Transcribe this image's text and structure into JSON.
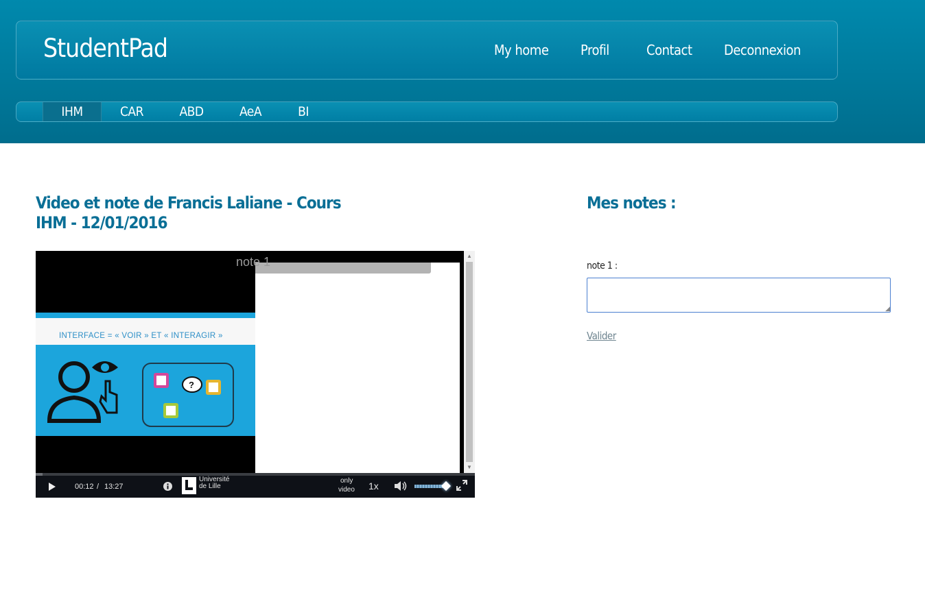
{
  "brand": "StudentPad",
  "nav": [
    "My home",
    "Profil",
    "Contact",
    "Deconnexion"
  ],
  "tabs": [
    "IHM",
    "CAR",
    "ABD",
    "AeA",
    "BI"
  ],
  "active_tab": "IHM",
  "page_title": "Video et note de Francis Laliane - Cours IHM - 12/01/2016",
  "notes_heading": "Mes notes :",
  "video": {
    "note_overlay_label": "note 1",
    "slide_text": "INTERFACE = « VOIR » ET « INTERAGIR »",
    "current_time": "00:12",
    "separator": "/",
    "duration": "13:27",
    "progress": 0.015,
    "volume": 0.95,
    "university_line1": "Université",
    "university_line2": "de Lille",
    "mode_line1": "only",
    "mode_line2": "video",
    "speed": "1x"
  },
  "form": {
    "field_label": "note 1 :",
    "field_value": "",
    "submit_label": "Valider"
  },
  "colors": {
    "header": "#0082a6",
    "heading": "#0a6f96",
    "slide_bg": "#1ca5dc"
  }
}
